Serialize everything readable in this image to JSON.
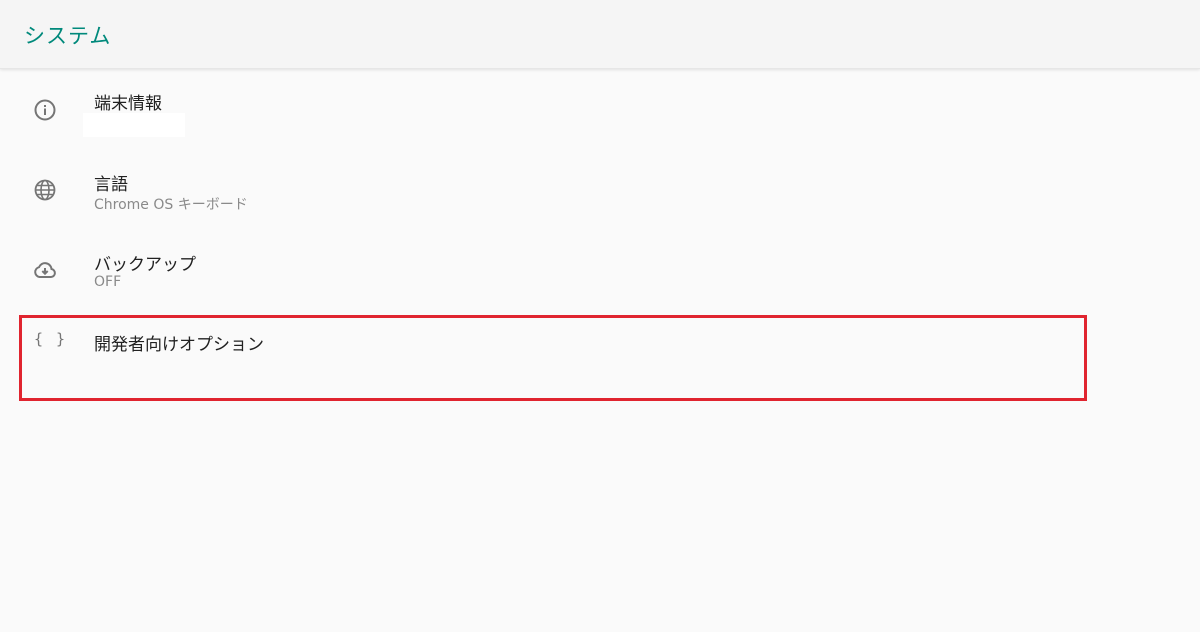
{
  "appbar": {
    "title": "システム"
  },
  "items": [
    {
      "title": "端末情報",
      "summary": "",
      "icon": "info-icon"
    },
    {
      "title": "言語",
      "summary": "Chrome OS キーボード",
      "icon": "globe-icon"
    },
    {
      "title": "バックアップ",
      "summary": "OFF",
      "icon": "cloud-download-icon"
    },
    {
      "title": "開発者向けオプション",
      "summary": "",
      "icon": "code-braces-icon",
      "glyph": "{ }"
    }
  ],
  "colors": {
    "accent": "#00897b",
    "highlight_box": "#e0242f",
    "background": "#fafafa"
  }
}
